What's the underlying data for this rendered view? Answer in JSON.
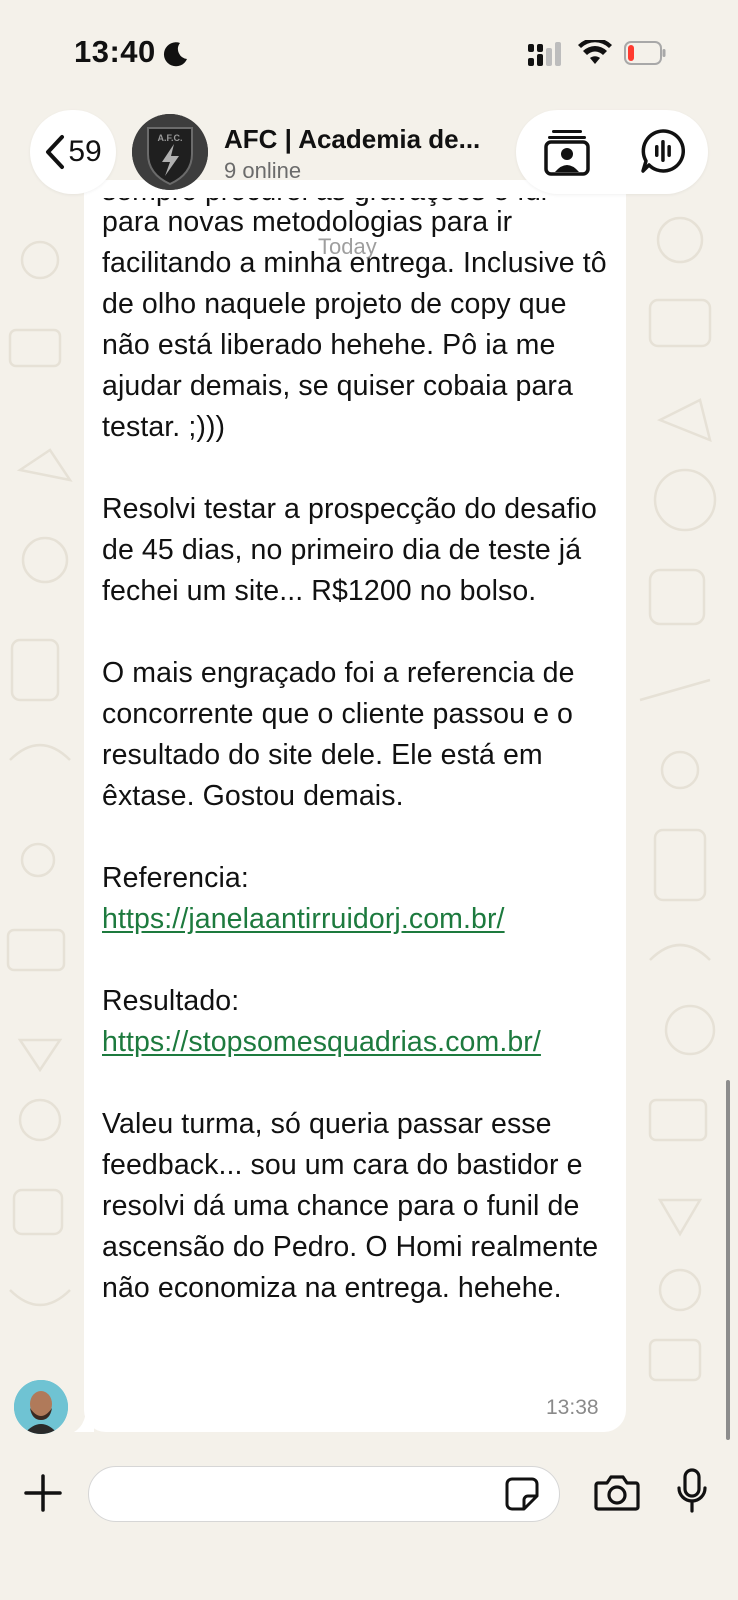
{
  "status_bar": {
    "time": "13:40",
    "icons": [
      "moon-icon",
      "cellular-signal-icon",
      "wifi-icon",
      "battery-low-icon"
    ],
    "battery_color": "#ff3b30"
  },
  "header": {
    "back_count": "59",
    "group_name": "AFC | Academia de...",
    "group_status": "9 online",
    "avatar_text": "A.F.C.",
    "icons": [
      "back-chevron-icon",
      "contact-card-icon",
      "voice-chat-icon"
    ]
  },
  "chat": {
    "date_chip": "Today",
    "partial_top_line": "sempre procurei as gravações e fui migrando",
    "paragraphs": [
      {
        "text": "para novas metodologias para ir facilitando a minha entrega. Inclusive tô de olho naquele projeto de copy que não está liberado hehehe. Pô ia me ajudar demais, se quiser cobaia para testar. ;)))"
      },
      {
        "text": "Resolvi testar a prospecção do desafio de 45 dias, no primeiro dia de teste já fechei um site... R$1200 no bolso."
      },
      {
        "text": "O mais engraçado foi a referencia de concorrente que o cliente passou e o resultado do site dele. Ele está em êxtase. Gostou demais."
      },
      {
        "label": "Referencia: ",
        "link": "https://janelaantirruidorj.com.br/"
      },
      {
        "label": "Resultado: ",
        "link": "https://stopsomesquadrias.com.br/"
      },
      {
        "text": "Valeu turma, só queria passar esse feedback... sou um cara do bastidor e resolvi dá uma chance para o funil de ascensão do Pedro. O Homi realmente não economiza na entrega. hehehe."
      }
    ],
    "message_time": "13:38",
    "link_color": "#1d7a3e"
  },
  "input_bar": {
    "placeholder": "",
    "icons": [
      "plus-icon",
      "sticker-icon",
      "camera-icon",
      "microphone-icon"
    ]
  }
}
